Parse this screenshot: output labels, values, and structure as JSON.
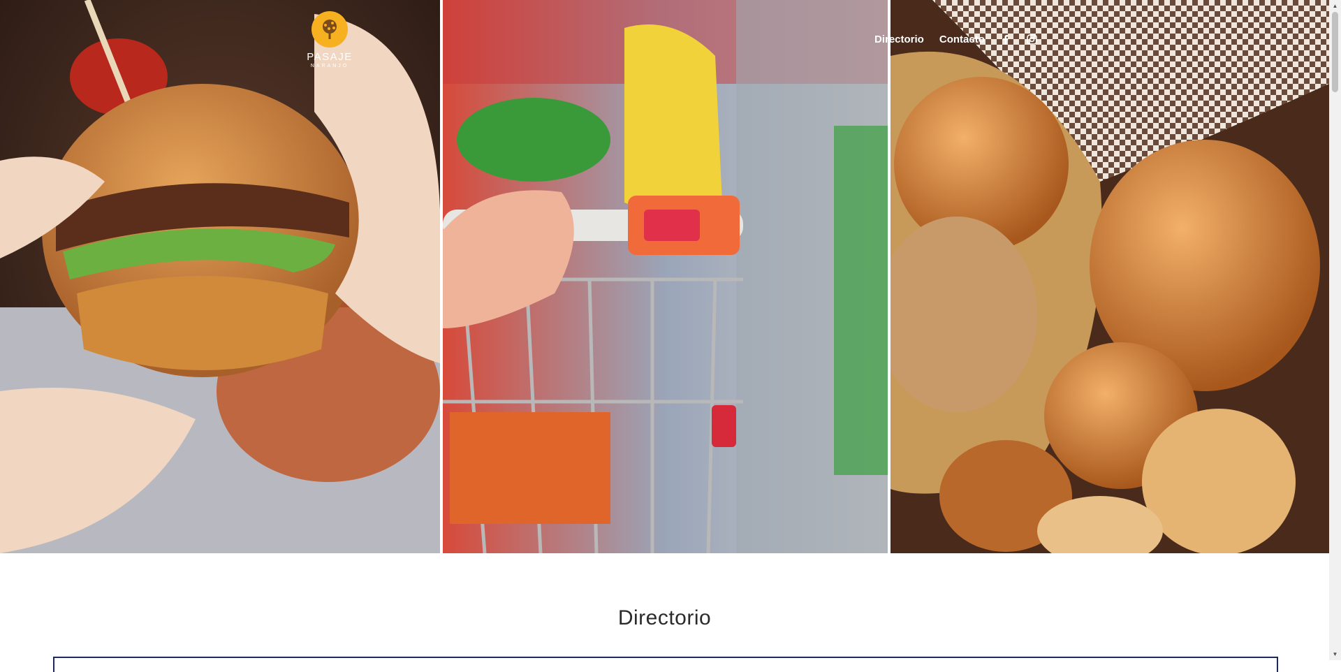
{
  "brand": {
    "name": "PASAJE",
    "subtitle": "NARANJO",
    "accent": "#f6b020"
  },
  "nav": {
    "items": [
      {
        "label": "Directorio"
      },
      {
        "label": "Contacto"
      }
    ],
    "social": [
      {
        "icon": "facebook-icon"
      },
      {
        "icon": "instagram-icon"
      }
    ]
  },
  "hero": {
    "panels": [
      {
        "subject": "burger-photo"
      },
      {
        "subject": "shopping-cart-photo"
      },
      {
        "subject": "bread-basket-photo"
      }
    ]
  },
  "main": {
    "section_title": "Directorio",
    "border_color": "#1a2a5a"
  }
}
